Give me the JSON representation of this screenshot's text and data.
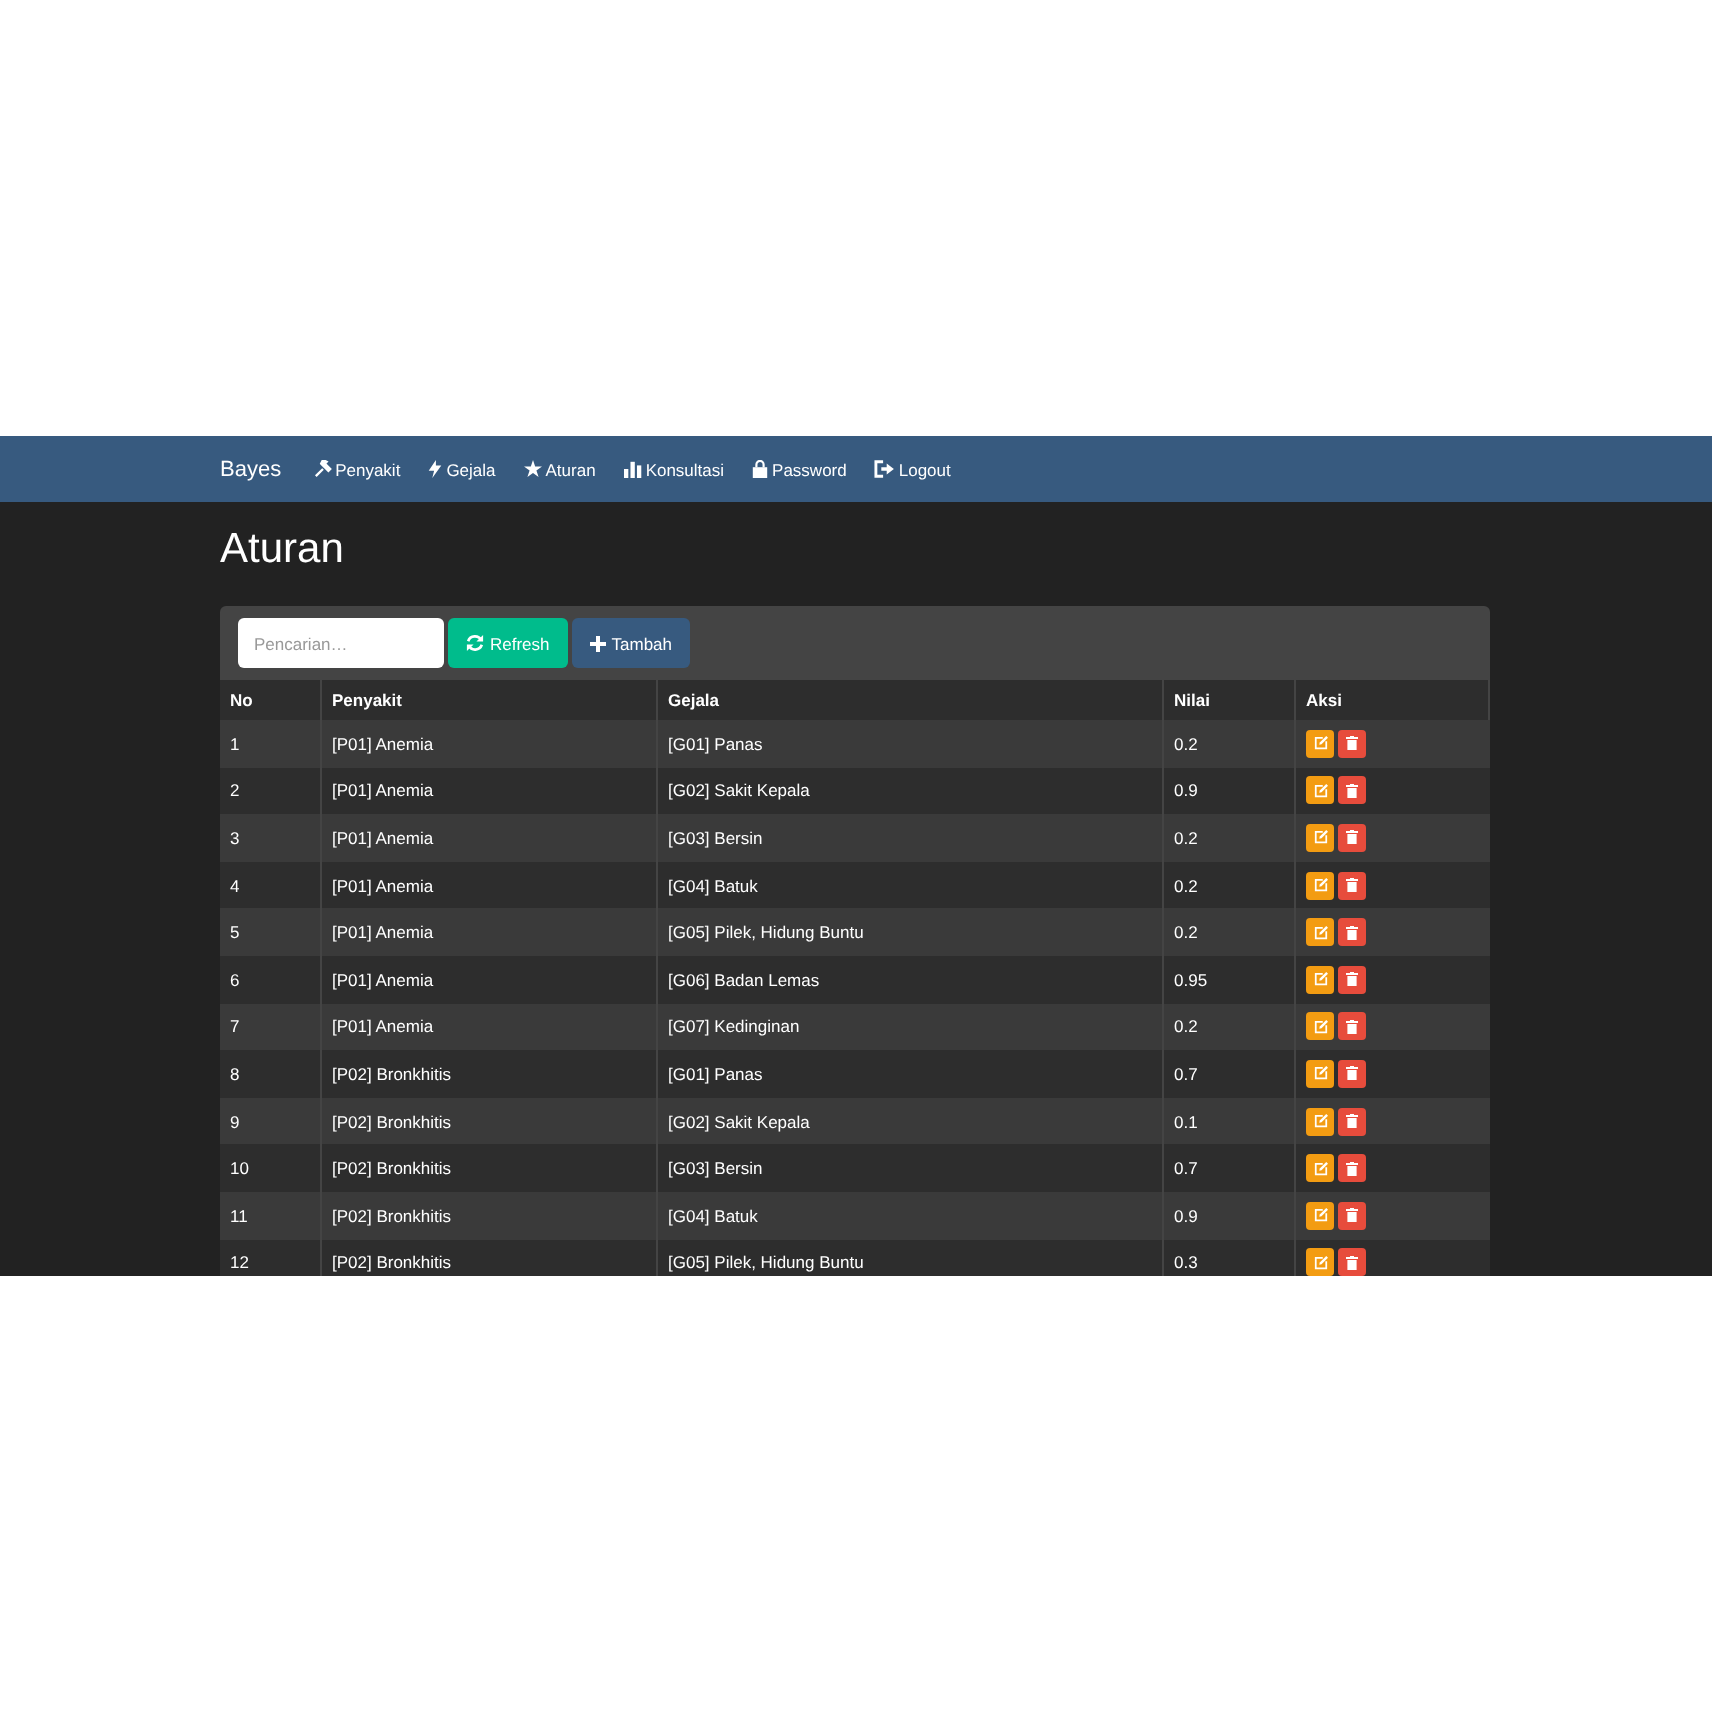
{
  "navbar": {
    "brand": "Bayes",
    "items": [
      {
        "label": "Penyakit",
        "kind": "disease"
      },
      {
        "label": "Gejala",
        "kind": "symptom"
      },
      {
        "label": "Aturan",
        "kind": "rule"
      },
      {
        "label": "Konsultasi",
        "kind": "consult"
      },
      {
        "label": "Password",
        "kind": "password"
      },
      {
        "label": "Logout",
        "kind": "logout"
      }
    ]
  },
  "page_title": "Aturan",
  "toolbar": {
    "search": {
      "placeholder": "Pencarian…"
    },
    "buttons": [
      {
        "label": "Refresh",
        "kind": "refresh"
      },
      {
        "label": "Tambah",
        "kind": "add"
      }
    ]
  },
  "table": {
    "columns": [
      "No",
      "Penyakit",
      "Gejala",
      "Nilai",
      "Aksi"
    ],
    "rows": [
      {
        "no": "1",
        "penyakit": "[P01] Anemia",
        "gejala": "[G01] Panas",
        "nilai": "0.2"
      },
      {
        "no": "2",
        "penyakit": "[P01] Anemia",
        "gejala": "[G02] Sakit Kepala",
        "nilai": "0.9"
      },
      {
        "no": "3",
        "penyakit": "[P01] Anemia",
        "gejala": "[G03] Bersin",
        "nilai": "0.2"
      },
      {
        "no": "4",
        "penyakit": "[P01] Anemia",
        "gejala": "[G04] Batuk",
        "nilai": "0.2"
      },
      {
        "no": "5",
        "penyakit": "[P01] Anemia",
        "gejala": "[G05] Pilek, Hidung Buntu",
        "nilai": "0.2"
      },
      {
        "no": "6",
        "penyakit": "[P01] Anemia",
        "gejala": "[G06] Badan Lemas",
        "nilai": "0.95"
      },
      {
        "no": "7",
        "penyakit": "[P01] Anemia",
        "gejala": "[G07] Kedinginan",
        "nilai": "0.2"
      },
      {
        "no": "8",
        "penyakit": "[P02] Bronkhitis",
        "gejala": "[G01] Panas",
        "nilai": "0.7"
      },
      {
        "no": "9",
        "penyakit": "[P02] Bronkhitis",
        "gejala": "[G02] Sakit Kepala",
        "nilai": "0.1"
      },
      {
        "no": "10",
        "penyakit": "[P02] Bronkhitis",
        "gejala": "[G03] Bersin",
        "nilai": "0.7"
      },
      {
        "no": "11",
        "penyakit": "[P02] Bronkhitis",
        "gejala": "[G04] Batuk",
        "nilai": "0.9"
      },
      {
        "no": "12",
        "penyakit": "[P02] Bronkhitis",
        "gejala": "[G05] Pilek, Hidung Buntu",
        "nilai": "0.3"
      }
    ]
  }
}
